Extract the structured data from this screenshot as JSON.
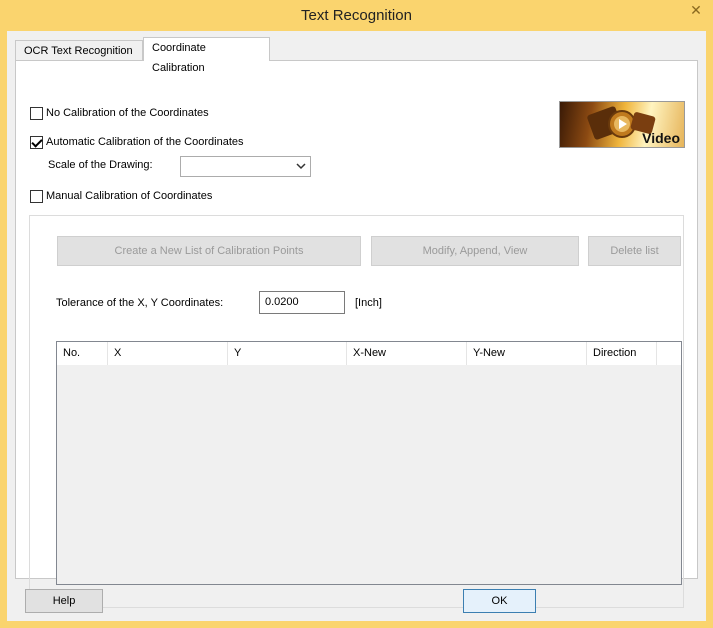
{
  "window": {
    "title": "Text Recognition",
    "close_glyph": "✕"
  },
  "tabs": [
    {
      "label": "OCR Text Recognition"
    },
    {
      "label": "Coordinate Calibration"
    }
  ],
  "calibration": {
    "no_calibration": {
      "label": "No Calibration of the Coordinates",
      "checked": false
    },
    "automatic": {
      "label": "Automatic Calibration of the Coordinates",
      "checked": true
    },
    "scale_label": "Scale of the Drawing:",
    "scale_value": "",
    "manual": {
      "label": "Manual Calibration of Coordinates",
      "checked": false
    }
  },
  "video_logo": {
    "text": "Video",
    "icon": "film-reel-play-icon"
  },
  "buttons": {
    "create": "Create a New List of Calibration Points",
    "modify": "Modify, Append, View",
    "delete": "Delete list",
    "help": "Help",
    "ok": "OK"
  },
  "tolerance": {
    "label": "Tolerance of the X, Y Coordinates:",
    "value": "0.0200",
    "unit": "[Inch]"
  },
  "table": {
    "columns": [
      "No.",
      "X",
      "Y",
      "X-New",
      "Y-New",
      "Direction"
    ],
    "rows": []
  }
}
